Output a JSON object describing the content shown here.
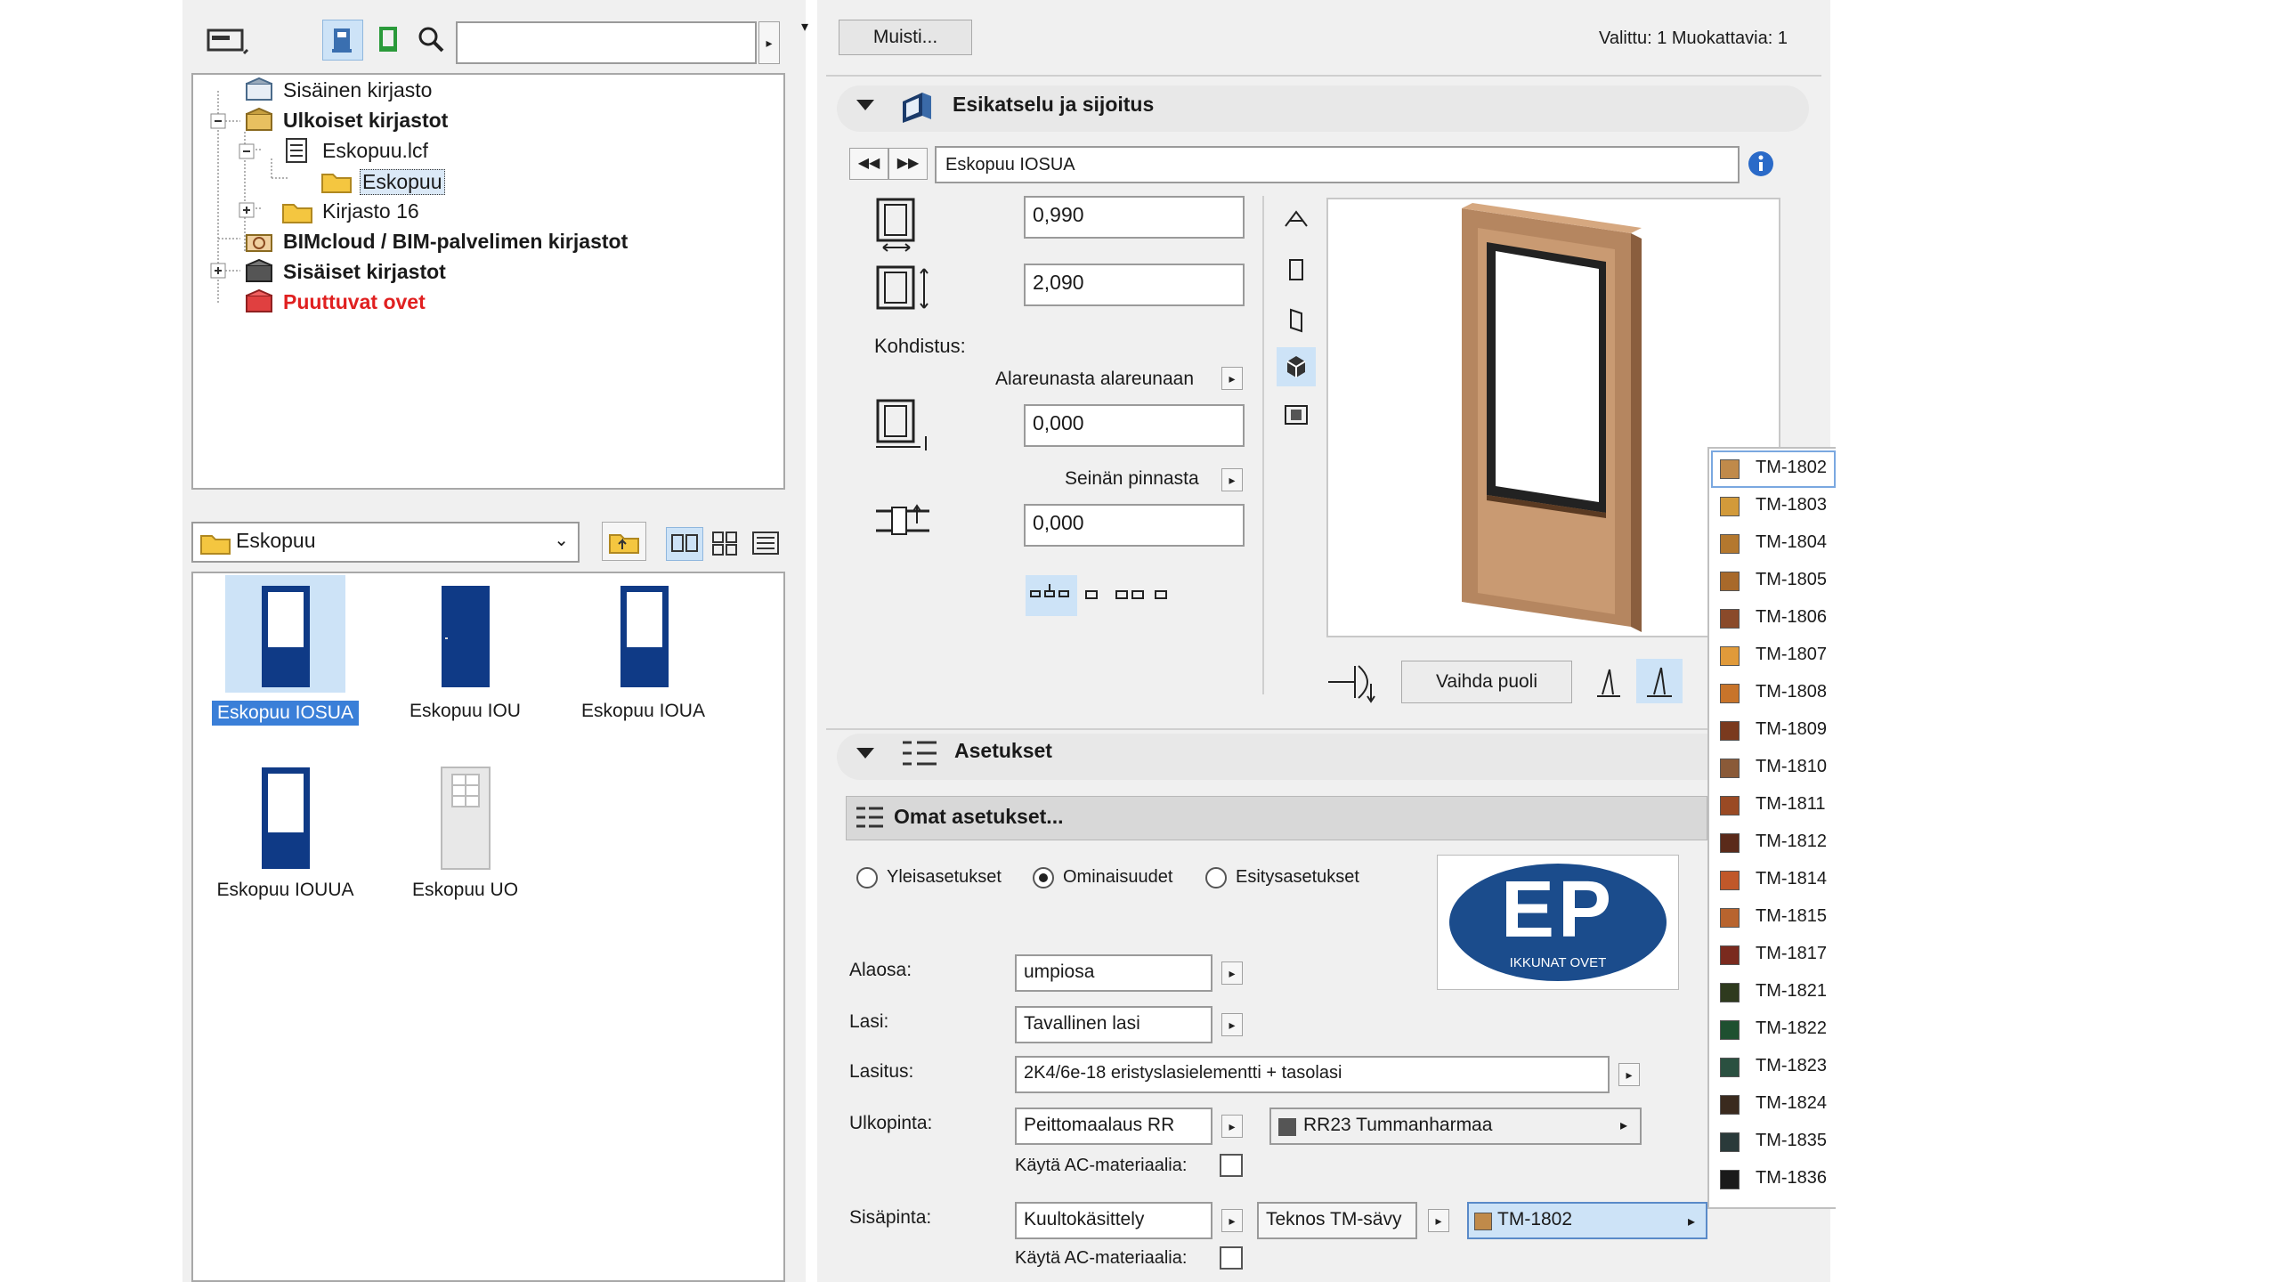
{
  "library_tree": {
    "search_placeholder": "",
    "items": [
      {
        "label": "Sisäinen kirjasto",
        "bold": false
      },
      {
        "label": "Ulkoiset kirjastot",
        "bold": true
      },
      {
        "label": "Eskopuu.lcf",
        "bold": false
      },
      {
        "label": "Eskopuu",
        "bold": false
      },
      {
        "label": "Kirjasto 16",
        "bold": false
      },
      {
        "label": "BIMcloud / BIM-palvelimen kirjastot",
        "bold": true
      },
      {
        "label": "Sisäiset kirjastot",
        "bold": true
      },
      {
        "label": "Puuttuvat ovet",
        "bold": true,
        "color": "#e02020"
      }
    ]
  },
  "folder_select": {
    "value": "Eskopuu"
  },
  "thumbnails": [
    {
      "label": "Eskopuu IOSUA",
      "selected": true
    },
    {
      "label": "Eskopuu IOU"
    },
    {
      "label": "Eskopuu IOUA"
    },
    {
      "label": "Eskopuu IOUUA"
    },
    {
      "label": "Eskopuu UO"
    }
  ],
  "header": {
    "memo_button": "Muisti...",
    "status": "Valittu: 1 Muokattavia: 1"
  },
  "preview_section": {
    "title": "Esikatselu ja sijoitus",
    "object_name": "Eskopuu IOSUA",
    "width_value": "0,990",
    "height_value": "2,090",
    "anchor_label": "Kohdistus:",
    "anchor_mode": "Alareunasta alareunaan",
    "sill_value": "0,000",
    "wall_ref_label": "Seinän pinnasta",
    "offset_value": "0,000",
    "flip_button": "Vaihda puoli"
  },
  "settings_section": {
    "title": "Asetukset",
    "custom_settings": "Omat asetukset...",
    "tabs": [
      {
        "label": "Yleisasetukset",
        "selected": false
      },
      {
        "label": "Ominaisuudet",
        "selected": true
      },
      {
        "label": "Esitysasetukset",
        "selected": false
      }
    ],
    "logo_text": "EP",
    "logo_subtext": "IKKUNAT OVET",
    "rows": {
      "alaosa_label": "Alaosa:",
      "alaosa_value": "umpiosa",
      "lasi_label": "Lasi:",
      "lasi_value": "Tavallinen lasi",
      "lasitus_label": "Lasitus:",
      "lasitus_value": "2K4/6e-18 eristyslasielementti + tasolasi",
      "ulkopinta_label": "Ulkopinta:",
      "ulkopinta_value": "Peittomaalaus RR",
      "ulkopinta_color": "RR23 Tummanharmaa",
      "ac_label_1": "Käytä AC-materiaalia:",
      "sisapinta_label": "Sisäpinta:",
      "sisapinta_value": "Kuultokäsittely",
      "sisapinta_shade": "Teknos TM-sävy",
      "sisapinta_color": "TM-1802",
      "ac_label_2": "Käytä AC-materiaalia:"
    }
  },
  "color_list": [
    {
      "code": "TM-1802",
      "color": "#c08a4a"
    },
    {
      "code": "TM-1803",
      "color": "#d29a3a"
    },
    {
      "code": "TM-1804",
      "color": "#b4782e"
    },
    {
      "code": "TM-1805",
      "color": "#a8692a"
    },
    {
      "code": "TM-1806",
      "color": "#8a4a2a"
    },
    {
      "code": "TM-1807",
      "color": "#e09a3a"
    },
    {
      "code": "TM-1808",
      "color": "#c8742a"
    },
    {
      "code": "TM-1809",
      "color": "#7a3a1e"
    },
    {
      "code": "TM-1810",
      "color": "#8a5a38"
    },
    {
      "code": "TM-1811",
      "color": "#9a4a24"
    },
    {
      "code": "TM-1812",
      "color": "#5a2a1a"
    },
    {
      "code": "TM-1814",
      "color": "#c0582a"
    },
    {
      "code": "TM-1815",
      "color": "#b8642e"
    },
    {
      "code": "TM-1817",
      "color": "#7a2a1e"
    },
    {
      "code": "TM-1821",
      "color": "#2e3a1e"
    },
    {
      "code": "TM-1822",
      "color": "#1e5030"
    },
    {
      "code": "TM-1823",
      "color": "#2a5040"
    },
    {
      "code": "TM-1824",
      "color": "#3a2a1e"
    },
    {
      "code": "TM-1835",
      "color": "#2a3a3a"
    },
    {
      "code": "TM-1836",
      "color": "#1a1a1a"
    }
  ]
}
